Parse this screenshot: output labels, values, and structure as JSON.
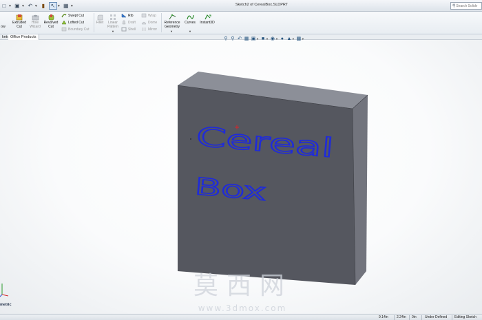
{
  "window": {
    "title": "Sketch2 of CerealBox.SLDPRT",
    "search_placeholder": "Search Solidv"
  },
  "quick_access": [
    "new-icon",
    "open-icon",
    "save-icon",
    "print-icon",
    "undo-icon",
    "select-icon",
    "rebuild-icon",
    "options-icon"
  ],
  "ribbon": {
    "partial_left_label": "ow",
    "extruded_cut": "Extruded\nCut",
    "hole_wizard": "Hole\nWizard",
    "revolved_cut": "Revolved\nCut",
    "swept_cut": "Swept Cut",
    "lofted_cut": "Lofted Cut",
    "boundary_cut": "Boundary Cut",
    "fillet": "Fillet",
    "linear_pattern": "Linear\nPattern",
    "rib": "Rib",
    "draft": "Draft",
    "shell": "Shell",
    "wrap": "Wrap",
    "dome": "Dome",
    "mirror": "Mirror",
    "reference_geometry": "Reference\nGeometry",
    "curves": "Curves",
    "instant3d": "Instant3D"
  },
  "tabs": [
    {
      "label": "ketch",
      "active": false
    },
    {
      "label": "Office Products",
      "active": true
    }
  ],
  "hud_icons": [
    "zoom-to-fit-icon",
    "zoom-to-area-icon",
    "previous-view-icon",
    "section-view-icon",
    "view-orientation-icon",
    "display-style-icon",
    "hide-show-items-icon",
    "edit-appearance-icon",
    "apply-scene-icon",
    "view-settings-icon"
  ],
  "model": {
    "sketch_text_line1": "Cereal",
    "sketch_text_line2": "Box",
    "colors": {
      "front_face": "#55575f",
      "top_face": "#8c8f98",
      "side_face": "#72747d",
      "sketch": "#1f2bd9",
      "origin": "#d8262b"
    }
  },
  "view_label": "metric",
  "watermark": {
    "chars": "莫西网",
    "url": "www.3dmox.com"
  },
  "status": {
    "x": "9.14in",
    "y": "2.24in",
    "z": "0in",
    "state": "Under Defined",
    "mode": "Editing Sketch"
  }
}
